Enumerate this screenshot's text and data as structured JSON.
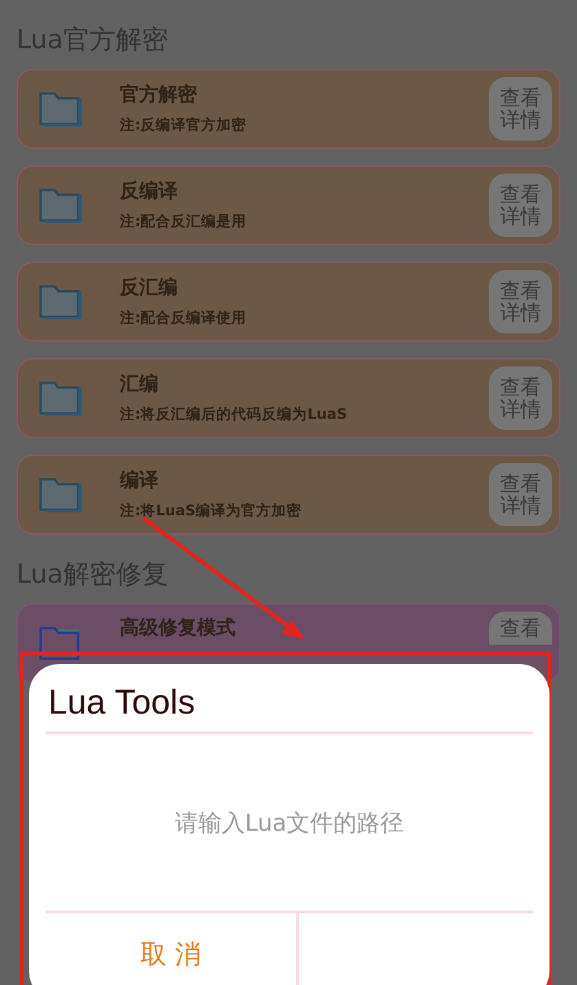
{
  "sections": [
    {
      "title": "Lua官方解密",
      "kind": "official",
      "cards": [
        {
          "title": "官方解密",
          "note": "注:反编译官方加密",
          "button": "查看详情"
        },
        {
          "title": "反编译",
          "note": "注:配合反汇编是用",
          "button": "查看详情"
        },
        {
          "title": "反汇编",
          "note": "注:配合反编译使用",
          "button": "查看详情"
        },
        {
          "title": "汇编",
          "note": "注:将反汇编后的代码反编为LuaS",
          "button": "查看详情"
        },
        {
          "title": "编译",
          "note": "注:将LuaS编译为官方加密",
          "button": "查看详情"
        }
      ]
    },
    {
      "title": "Lua解密修复",
      "kind": "repair",
      "cards": [
        {
          "title": "高级修复模式",
          "button": "查看"
        }
      ]
    }
  ],
  "dialog": {
    "title": "Lua Tools",
    "message": "请输入Lua文件的路径",
    "cancel": "取 消"
  }
}
